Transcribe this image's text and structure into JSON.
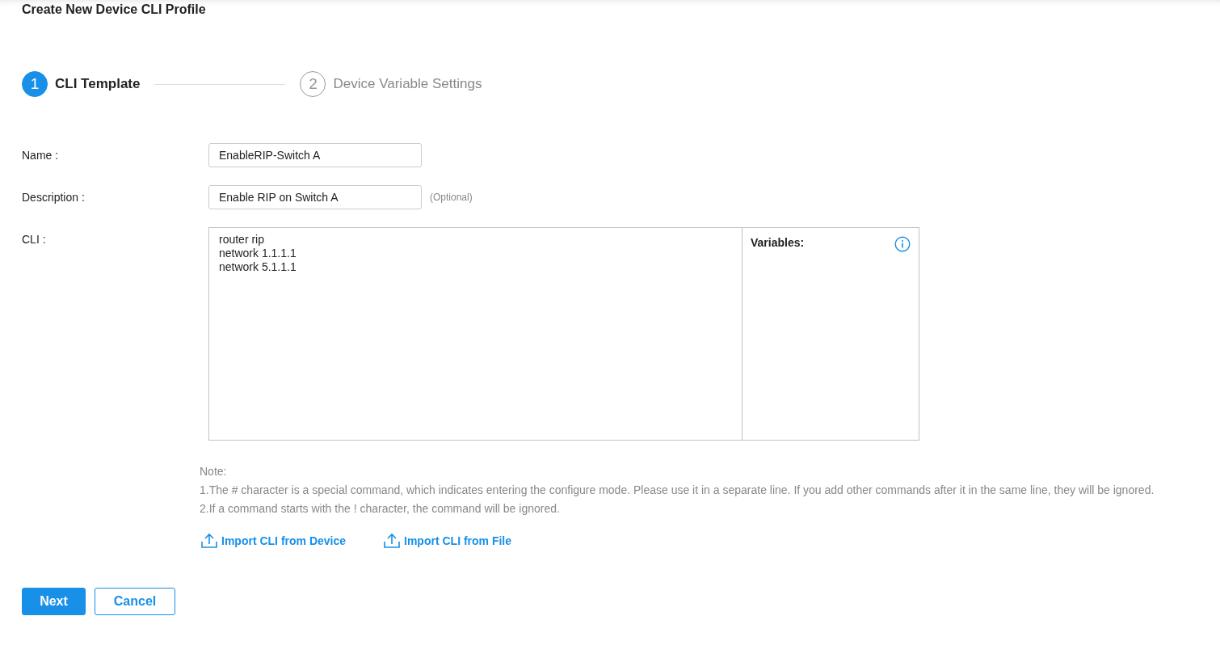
{
  "title": "Create New Device CLI Profile",
  "steps": [
    {
      "number": "1",
      "label": "CLI Template",
      "selected": true
    },
    {
      "number": "2",
      "label": "Device Variable Settings",
      "selected": false
    }
  ],
  "form": {
    "name": {
      "label": "Name :",
      "value": "EnableRIP-Switch A"
    },
    "description": {
      "label": "Description :",
      "value": "Enable RIP on Switch A",
      "hint": "(Optional)"
    },
    "cli": {
      "label": "CLI :",
      "lines": [
        "router rip",
        "network 1.1.1.1",
        "network 5.1.1.1"
      ],
      "variables_label": "Variables:"
    }
  },
  "note": {
    "heading": "Note:",
    "items": [
      "1.The # character is a special command, which indicates entering the configure mode. Please use it in a separate line. If you add other commands after it in the same line, they will be ignored.",
      "2.If a command starts with the ! character, the command will be ignored."
    ]
  },
  "import_links": [
    "Import CLI from Device",
    "Import CLI from File"
  ],
  "buttons": [
    {
      "label": "Next",
      "kind": "primary"
    },
    {
      "label": "Cancel",
      "kind": "secondary"
    }
  ]
}
